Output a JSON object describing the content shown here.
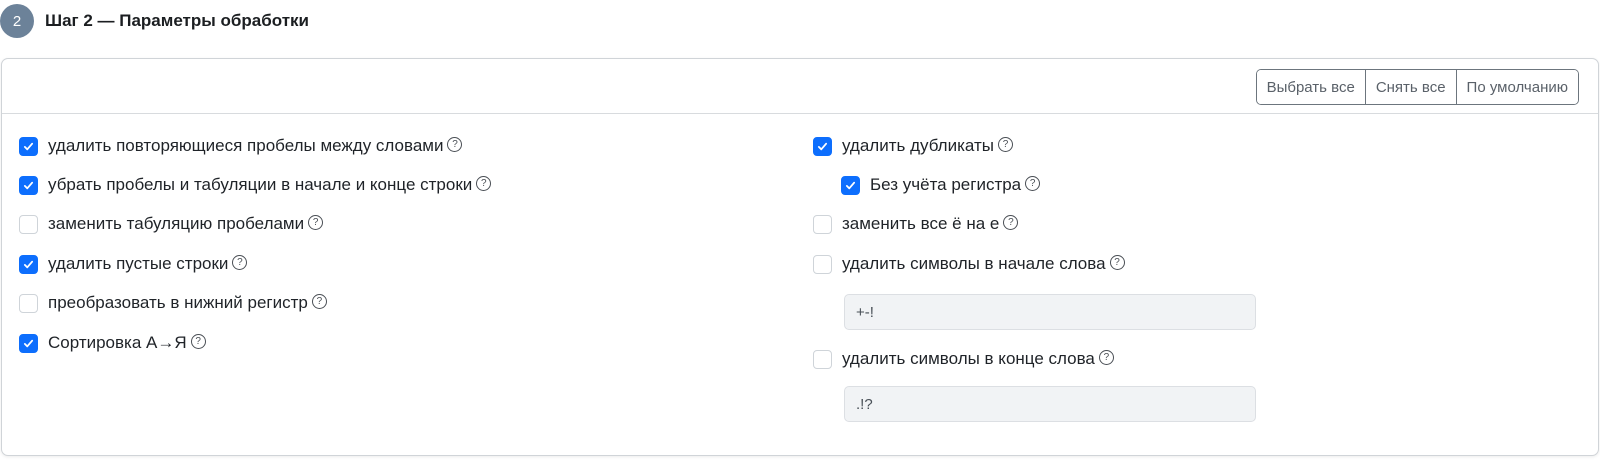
{
  "step": {
    "number": "2",
    "title": "Шаг 2 — Параметры обработки"
  },
  "toolbar": {
    "select_all": "Выбрать все",
    "clear_all": "Снять все",
    "default": "По умолчанию"
  },
  "options": {
    "remove_double_spaces": {
      "label": "удалить повторяющиеся пробелы между словами",
      "checked": true
    },
    "trim_lines": {
      "label": "убрать пробелы и табуляции в начале и конце строки",
      "checked": true
    },
    "tabs_to_spaces": {
      "label": "заменить табуляцию пробелами",
      "checked": false
    },
    "remove_empty_lines": {
      "label": "удалить пустые строки",
      "checked": true
    },
    "to_lowercase": {
      "label": "преобразовать в нижний регистр",
      "checked": false
    },
    "sort_az": {
      "label": "Сортировка А→Я",
      "checked": true
    },
    "remove_duplicates": {
      "label": "удалить дубликаты",
      "checked": true
    },
    "case_insensitive": {
      "label": "Без учёта регистра",
      "checked": true
    },
    "replace_yo": {
      "label": "заменить все ё на е",
      "checked": false
    },
    "strip_word_start": {
      "label": "удалить символы в начале слова",
      "checked": false,
      "value": "+-!"
    },
    "strip_word_end": {
      "label": "удалить символы в конце слова",
      "checked": false,
      "value": ".!?"
    }
  },
  "help_glyph": "?",
  "colors": {
    "accent": "#0d6efd",
    "step_badge": "#6c8299",
    "input_bg": "#f1f3f5"
  }
}
